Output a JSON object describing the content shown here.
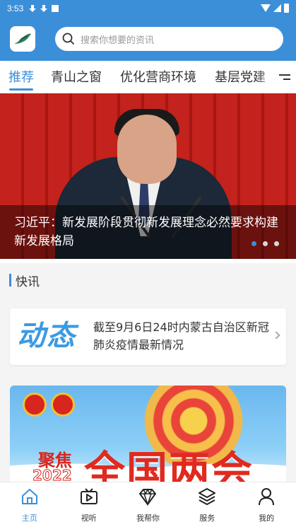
{
  "status_bar": {
    "time": "3:53"
  },
  "search": {
    "placeholder": "搜索你想要的资讯"
  },
  "tabs": [
    {
      "label": "推荐"
    },
    {
      "label": "青山之窗"
    },
    {
      "label": "优化营商环境"
    },
    {
      "label": "基层党建"
    }
  ],
  "banner": {
    "title": "习近平：新发展阶段贯彻新发展理念必然要求构建新发展格局",
    "slide_count": 3,
    "active_slide": 1
  },
  "flash": {
    "section_title": "快讯",
    "card_logo_text": "动态",
    "card_text": "截至9月6日24时内蒙古自治区新冠肺炎疫情最新情况"
  },
  "promo": {
    "focus": "聚焦",
    "year": "2022",
    "headline": "全国两会"
  },
  "bottom_nav": [
    {
      "label": "主页",
      "icon": "home-icon"
    },
    {
      "label": "视听",
      "icon": "video-icon"
    },
    {
      "label": "我帮你",
      "icon": "diamond-icon"
    },
    {
      "label": "服务",
      "icon": "layers-icon"
    },
    {
      "label": "我的",
      "icon": "user-icon"
    }
  ],
  "colors": {
    "accent": "#3b8fd9"
  }
}
